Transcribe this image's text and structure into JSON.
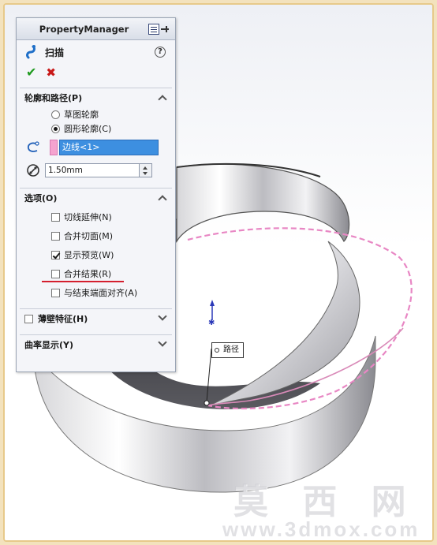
{
  "property_manager": {
    "title": "PropertyManager",
    "feature_name": "扫描",
    "help_label": "?",
    "ok_label": "✔",
    "cancel_label": "✖",
    "profile_path": {
      "heading": "轮廓和路径(P)",
      "option_sketch": "草图轮廓",
      "option_circle": "圆形轮廓(C)",
      "selected_option": "圆形轮廓(C)",
      "path_selection": "边线<1>",
      "diameter_value": "1.50mm"
    },
    "options": {
      "heading": "选项(O)",
      "items": [
        {
          "label": "切线延伸(N)",
          "checked": false
        },
        {
          "label": "合并切面(M)",
          "checked": false
        },
        {
          "label": "显示预览(W)",
          "checked": true
        },
        {
          "label": "合并结果(R)",
          "checked": false
        },
        {
          "label": "与结束端面对齐(A)",
          "checked": false
        }
      ]
    },
    "thin_feature": {
      "heading": "薄壁特征(H)",
      "checked": false
    },
    "curvature": {
      "heading": "曲率显示(Y)"
    }
  },
  "viewport": {
    "callout_label": "路径"
  },
  "watermark": {
    "title": "莫 西 网",
    "url": "www.3dmox.com"
  },
  "colors": {
    "frame_border": "#e7c98a",
    "selection_blue": "#3d8fe0",
    "path_pink": "#e887c4",
    "accent_red": "#d41f2e",
    "ok_green": "#1f9a1f"
  }
}
